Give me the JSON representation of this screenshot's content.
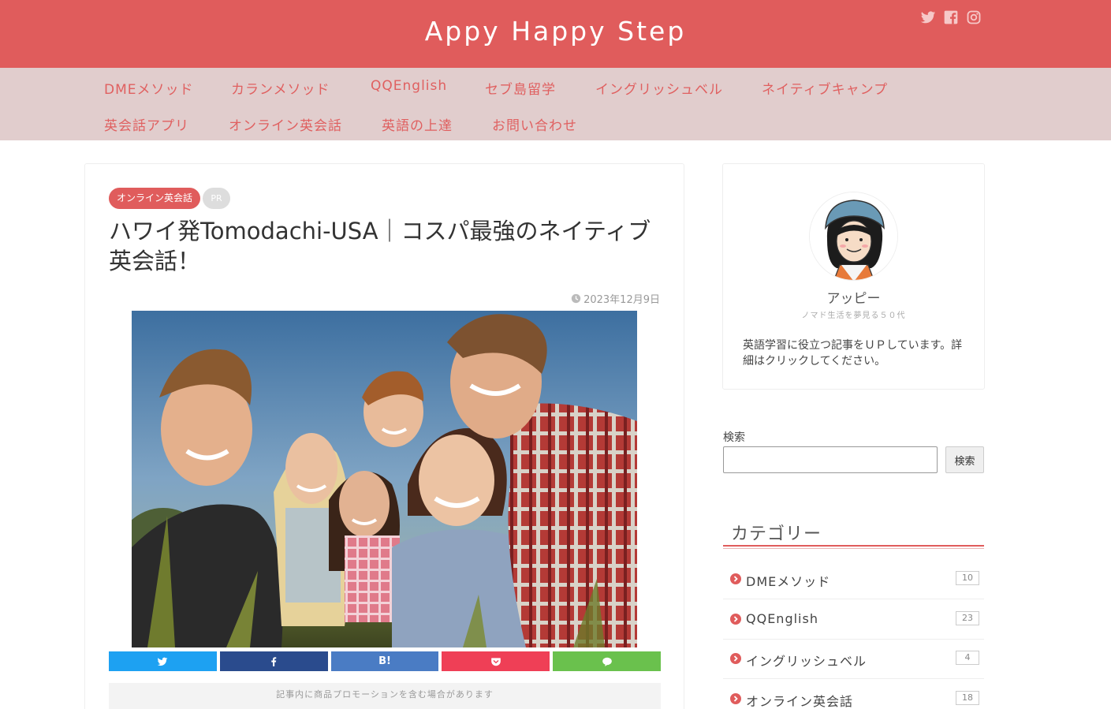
{
  "header": {
    "site_title": "Appy Happy Step",
    "social_icons": [
      "twitter-icon",
      "facebook-icon",
      "instagram-icon"
    ],
    "bg_color": "#e05c5c"
  },
  "nav": {
    "items": [
      "DMEメソッド",
      "カランメソッド",
      "QQEnglish",
      "セブ島留学",
      "イングリッシュベル",
      "ネイティブキャンプ",
      "英会話アプリ",
      "オンライン英会話",
      "英語の上達",
      "お問い合わせ"
    ],
    "bg_color": "#e1cdcd"
  },
  "article": {
    "category": "オンライン英会話",
    "pr": "PR",
    "title": "ハワイ発Tomodachi-USA｜コスパ最強のネイティブ英会話！",
    "date": "2023年12月9日",
    "share_buttons": [
      {
        "name": "twitter",
        "label": "",
        "color": "#1da1f2"
      },
      {
        "name": "facebook",
        "label": "",
        "color": "#2a4b8d"
      },
      {
        "name": "hatena",
        "label": "B!",
        "color": "#4a7cc4"
      },
      {
        "name": "pocket",
        "label": "",
        "color": "#ef3f56"
      },
      {
        "name": "line",
        "label": "",
        "color": "#6ac14d"
      }
    ],
    "promo_note": "記事内に商品プロモーションを含む場合があります"
  },
  "profile": {
    "name": "アッピー",
    "subtitle": "ノマド生活を夢見る５０代",
    "description": "英語学習に役立つ記事をＵＰしています。詳細はクリックしてください。"
  },
  "search": {
    "label": "検索",
    "value": "",
    "button": "検索"
  },
  "categories": {
    "heading": "カテゴリー",
    "items": [
      {
        "label": "DMEメソッド",
        "count": "10"
      },
      {
        "label": "QQEnglish",
        "count": "23"
      },
      {
        "label": "イングリッシュベル",
        "count": "4"
      },
      {
        "label": "オンライン英会話",
        "count": "18"
      }
    ]
  }
}
